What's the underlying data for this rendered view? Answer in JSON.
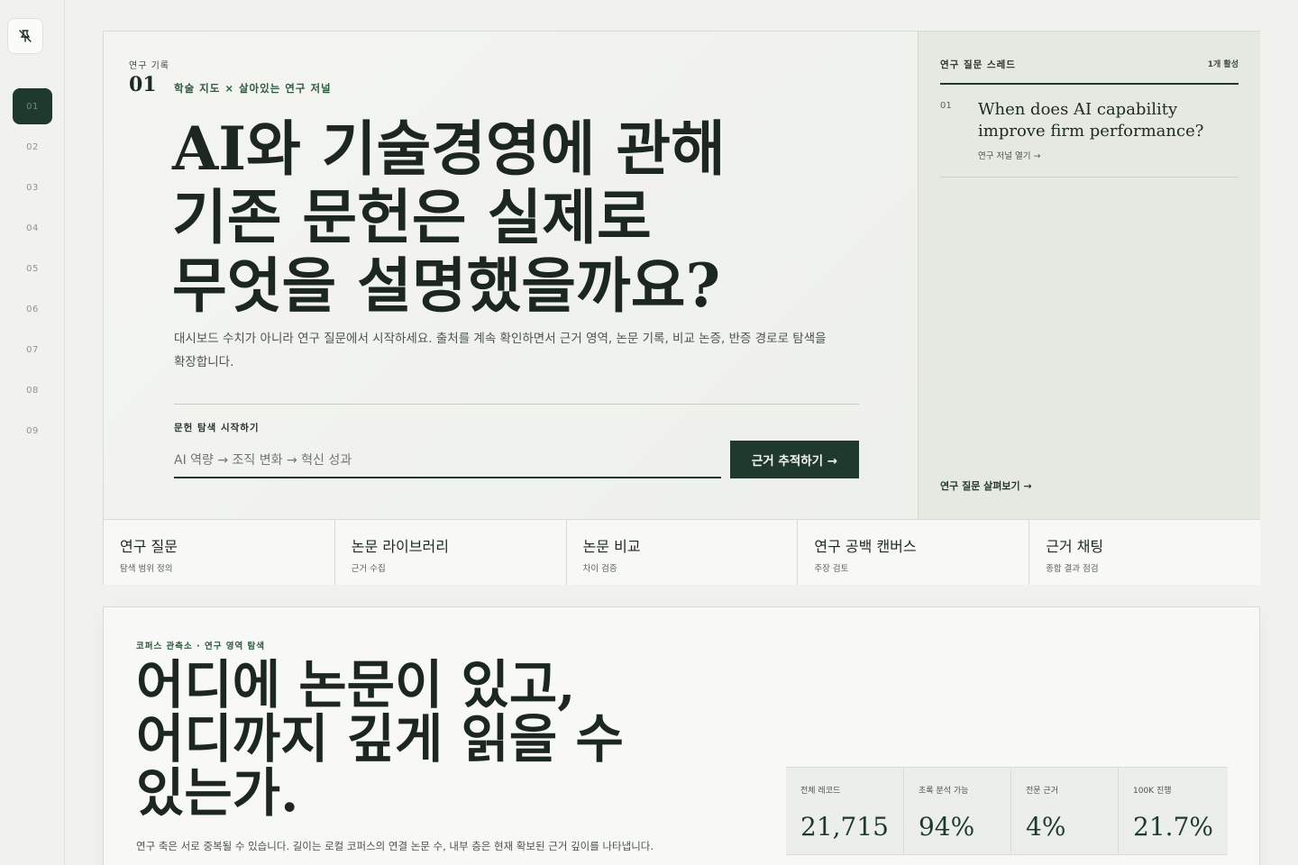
{
  "rail": {
    "logo_icon": "pin-off-icon",
    "items": [
      "01",
      "02",
      "03",
      "04",
      "05",
      "06",
      "07",
      "08",
      "09"
    ],
    "active": "01"
  },
  "hero": {
    "eyebrow": "연구 기록",
    "number": "01",
    "subtitle": "학술 지도 × 살아있는 연구 저널",
    "headline": [
      "AI와 기술경영에 관해",
      "기존 문헌은 실제로",
      "무엇을 설명했을까요?"
    ],
    "lead": "대시보드 수치가 아니라 연구 질문에서 시작하세요. 출처를 계속 확인하면서 근거 영역, 논문 기록, 비교 논증, 반증 경로로 탐색을 확장합니다.",
    "start_label": "문헌 탐색 시작하기",
    "search_placeholder": "AI 역량 → 조직 변화 → 혁신 성과",
    "trace_button": "근거 추적하기 →"
  },
  "thread": {
    "title": "연구 질문 스레드",
    "count": "1개 활성",
    "question": {
      "num": "01",
      "text": "When does AI capability improve firm performance?",
      "link": "연구 저널 열기 →"
    },
    "browse": "연구 질문 살펴보기 →"
  },
  "tabs": [
    {
      "title": "연구 질문",
      "sub": "탐색 범위 정의"
    },
    {
      "title": "논문 라이브러리",
      "sub": "근거 수집"
    },
    {
      "title": "논문 비교",
      "sub": "차이 검증"
    },
    {
      "title": "연구 공백 캔버스",
      "sub": "주장 검토"
    },
    {
      "title": "근거 채팅",
      "sub": "종합 결과 점검"
    }
  ],
  "corpus": {
    "eyebrow": "코퍼스 관측소 · 연구 영역 탐색",
    "headline": [
      "어디에 논문이 있고,",
      "어디까지 깊게 읽을 수",
      "있는가."
    ],
    "note": "연구 축은 서로 중복될 수 있습니다. 길이는 로컬 코퍼스의 연결 논문 수, 내부 층은 현재 확보된 근거 깊이를 나타냅니다.",
    "stats": [
      {
        "label": "전체 레코드",
        "value": "21,715"
      },
      {
        "label": "초록 분석 가능",
        "value": "94%"
      },
      {
        "label": "전문 근거",
        "value": "4%"
      },
      {
        "label": "100K 진행",
        "value": "21.7%"
      }
    ]
  },
  "colors": {
    "accent": "#1f3a2c",
    "accent_text": "#2c5a3e",
    "background": "#f1f2ee"
  }
}
